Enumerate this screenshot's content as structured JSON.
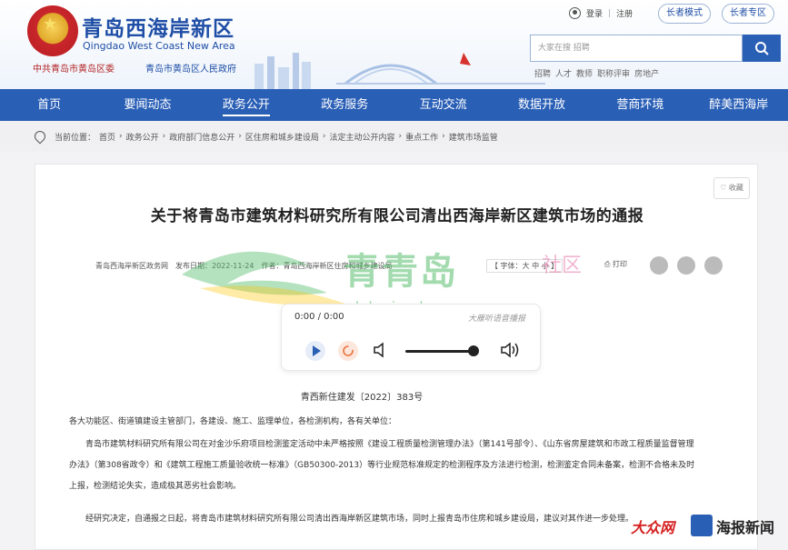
{
  "header": {
    "title": "青岛西海岸新区",
    "subtitle": "Qingdao West Coast New Area",
    "org_party": "中共青岛市黄岛区委",
    "org_gov": "青岛市黄岛区人民政府",
    "login": "登录",
    "register": "注册",
    "elder_mode": "长者模式",
    "elder_zone": "长者专区",
    "search_placeholder": "大家在搜 招聘",
    "hot_words": [
      "招聘",
      "人才",
      "教师",
      "职称评审",
      "房地产"
    ]
  },
  "nav": {
    "items": [
      "首页",
      "要闻动态",
      "政务公开",
      "政务服务",
      "互动交流",
      "数据开放",
      "营商环境",
      "醉美西海岸"
    ],
    "active_index": 2
  },
  "breadcrumb": {
    "label": "当前位置：",
    "items": [
      "首页",
      "政务公开",
      "政府部门信息公开",
      "区住房和城乡建设局",
      "法定主动公开内容",
      "重点工作",
      "建筑市场监管"
    ]
  },
  "article": {
    "favorite": "收藏",
    "title": "关于将青岛市建筑材料研究所有限公司清出西海岸新区建筑市场的通报",
    "source": "青岛西海岸新区政务网",
    "publish_date": "发布日期：2022-11-24",
    "author": "作者：青岛西海岸新区住房和城乡建设局",
    "font_size": "【 字体：大 中 小 】",
    "print": "打印",
    "doc_number": "青西新住建发〔2022〕383号",
    "addressee": "各大功能区、街道镇建设主管部门，各建设、施工、监理单位，各检测机构，各有关单位：",
    "para1": "青岛市建筑材料研究所有限公司在对金沙乐府项目检测鉴定活动中未严格按照《建设工程质量检测管理办法》（第141号部令）、《山东省房屋建筑和市政工程质量监督管理办法》（第308省政令）和《建筑工程施工质量验收统一标准》（GB50300-2013）等行业规范标准规定的检测程序及方法进行检测，检测鉴定合同未备案，检测不合格未及时上报，检测结论失实，造成极其恶劣社会影响。",
    "para2": "经研究决定，自通报之日起，将青岛市建筑材料研究所有限公司清出西海岸新区建筑市场，同时上报青岛市住房和城乡建设局，建议对其作进一步处理。"
  },
  "player": {
    "time": "0:00 / 0:00",
    "brand": "大雁听语音播报"
  },
  "watermark": {
    "title": "青青岛",
    "tag": "社区",
    "url": "club.qingdaonews.com"
  },
  "logos": {
    "dazhong": "大众网",
    "haibao": "海报新闻"
  }
}
